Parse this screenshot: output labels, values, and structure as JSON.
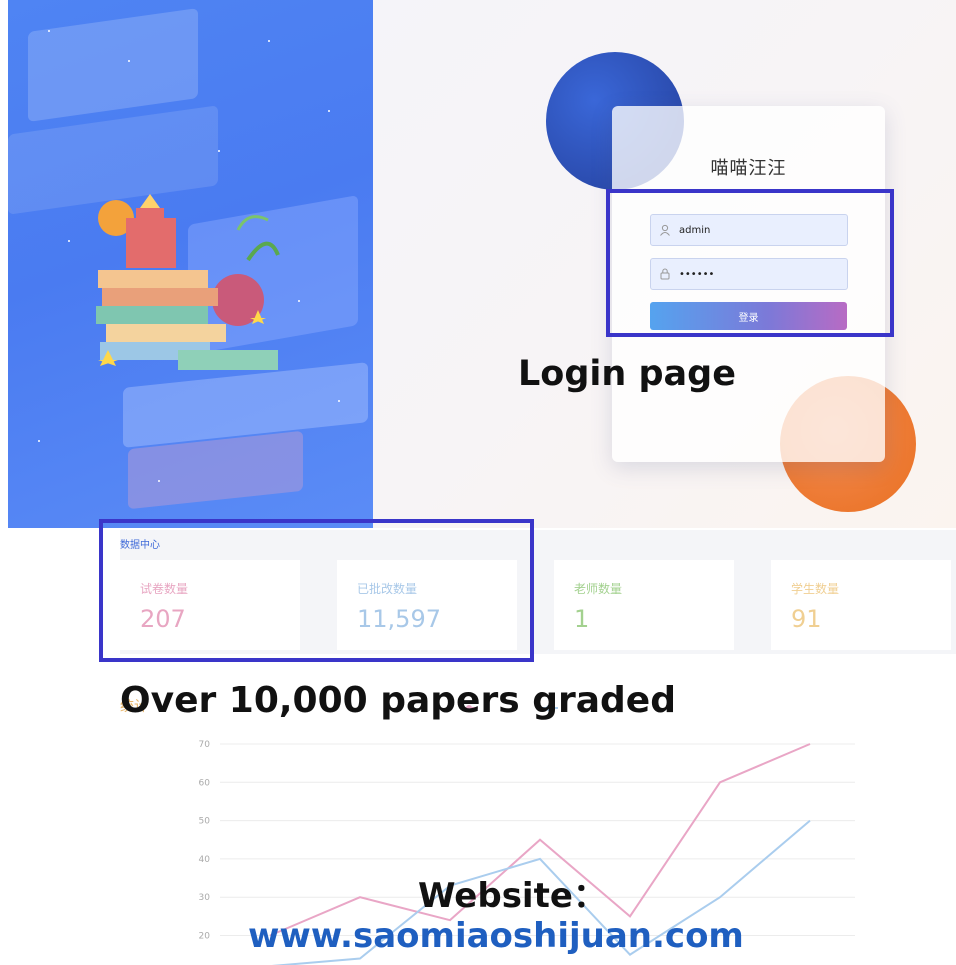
{
  "login": {
    "title": "喵喵汪汪",
    "username_value": "admin",
    "password_value": "••••••",
    "submit_label": "登录"
  },
  "captions": {
    "login": "Login page",
    "graded": "Over 10,000 papers graded",
    "website_label": "Website：",
    "website_url": "www.saomiaoshijuan.com"
  },
  "data_center": {
    "title": "数据中心",
    "stats": [
      {
        "label": "试卷数量",
        "value": "207",
        "color": "#e8a6c2"
      },
      {
        "label": "已批改数量",
        "value": "11,597",
        "color": "#a8c8e8"
      },
      {
        "label": "老师数量",
        "value": "1",
        "color": "#a3d18f"
      },
      {
        "label": "学生数量",
        "value": "91",
        "color": "#f0cf92"
      }
    ]
  },
  "chart": {
    "title": "统计",
    "series_colors": [
      "#e9a6c6",
      "#aacdee"
    ]
  },
  "chart_data": {
    "type": "line",
    "x": [
      1,
      2,
      3,
      4,
      5,
      6,
      7
    ],
    "yticks": [
      20,
      30,
      40,
      50,
      60,
      70
    ],
    "ylim": [
      15,
      70
    ],
    "series": [
      {
        "name": "",
        "values": [
          20,
          30,
          24,
          45,
          25,
          60,
          70
        ]
      },
      {
        "name": "",
        "values": [
          12,
          14,
          33,
          40,
          15,
          30,
          50
        ]
      }
    ],
    "grid": true
  },
  "icons": {
    "user": "user-icon",
    "lock": "lock-icon"
  }
}
